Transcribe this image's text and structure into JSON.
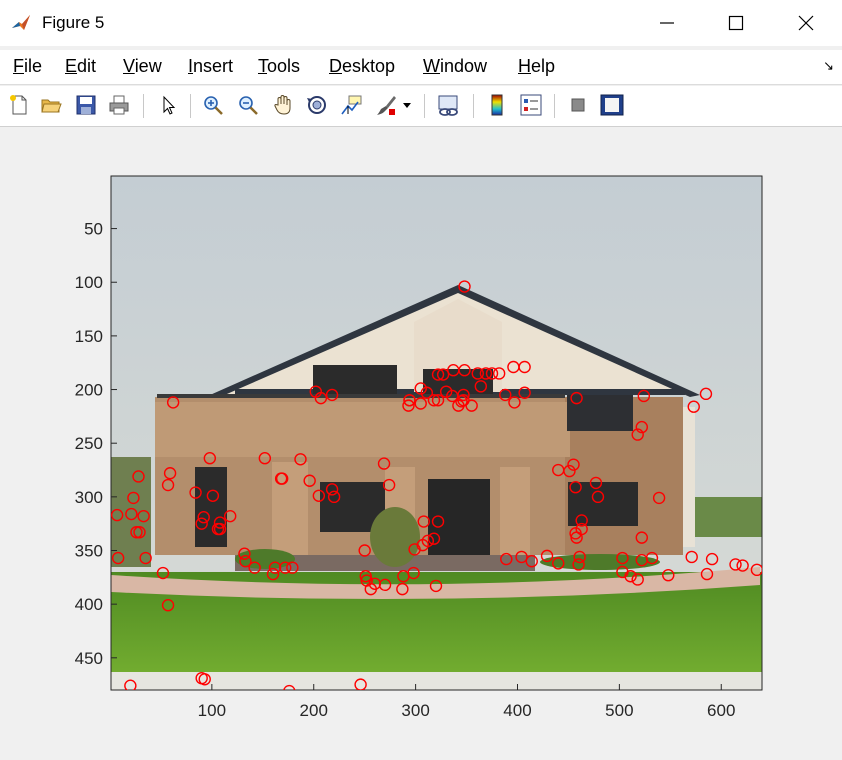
{
  "window": {
    "title": "Figure 5"
  },
  "menu": {
    "items": [
      {
        "mnemonic": "F",
        "rest": "ile"
      },
      {
        "mnemonic": "E",
        "rest": "dit"
      },
      {
        "mnemonic": "V",
        "rest": "iew"
      },
      {
        "mnemonic": "I",
        "rest": "nsert"
      },
      {
        "mnemonic": "T",
        "rest": "ools"
      },
      {
        "mnemonic": "D",
        "rest": "esktop"
      },
      {
        "mnemonic": "W",
        "rest": "indow"
      },
      {
        "mnemonic": "H",
        "rest": "elp"
      }
    ]
  },
  "toolbar": {
    "icons": [
      "new-figure-icon",
      "open-file-icon",
      "save-icon",
      "print-icon",
      "select-arrow-icon",
      "zoom-in-icon",
      "zoom-out-icon",
      "pan-hand-icon",
      "rotate-3d-icon",
      "data-cursor-icon",
      "brush-icon",
      "brush-dropdown-icon",
      "link-plot-icon",
      "colorbar-icon",
      "legend-icon",
      "hide-plot-tools-icon",
      "show-plot-tools-icon"
    ]
  },
  "axes": {
    "x_ticks": [
      "100",
      "200",
      "300",
      "400",
      "500",
      "600"
    ],
    "y_ticks": [
      "50",
      "100",
      "150",
      "200",
      "250",
      "300",
      "350",
      "400",
      "450"
    ],
    "x_range": [
      1,
      640
    ],
    "y_range": [
      1,
      480
    ],
    "y_reversed": true,
    "marker_color": "#ff0000"
  },
  "colors": {
    "sky": "#cfd6da",
    "roof": "#2f3640",
    "brick": "#b08c6a",
    "grass": "#5f9a2a",
    "walkway": "#d8b8a8"
  },
  "chart_data": {
    "type": "scatter",
    "x": [
      348,
      585,
      573,
      202,
      218,
      207,
      294,
      293,
      318,
      322,
      311,
      336,
      347,
      305,
      294,
      305,
      407,
      396,
      407,
      322,
      327,
      337,
      348,
      361,
      369,
      375,
      382,
      364,
      330,
      342,
      355,
      345,
      388,
      397,
      347,
      458,
      524,
      522,
      518,
      440,
      62,
      59,
      57,
      98,
      101,
      152,
      187,
      269,
      274,
      168,
      218,
      220,
      205,
      108,
      106,
      108,
      118,
      169,
      196,
      84,
      90,
      92,
      28,
      23,
      21,
      7,
      33,
      29,
      26,
      35,
      52,
      8,
      132,
      133,
      142,
      160,
      162,
      172,
      179,
      251,
      260,
      270,
      287,
      298,
      299,
      307,
      312,
      322,
      308,
      318,
      250,
      252,
      256,
      288,
      320,
      389,
      404,
      414,
      429,
      440,
      460,
      461,
      458,
      457,
      503,
      503,
      511,
      518,
      522,
      532,
      548,
      571,
      586,
      591,
      614,
      621,
      635,
      451,
      455,
      457,
      477,
      479,
      463,
      463,
      522,
      539,
      57,
      20,
      93,
      90,
      176,
      246
    ],
    "y": [
      104,
      204,
      216,
      202,
      205,
      208,
      210,
      215,
      210,
      210,
      203,
      206,
      210,
      199,
      210,
      213,
      203,
      179,
      179,
      186,
      186,
      182,
      182,
      185,
      185,
      185,
      185,
      197,
      202,
      215,
      215,
      211,
      205,
      212,
      205,
      208,
      206,
      235,
      242,
      275,
      212,
      278,
      289,
      264,
      299,
      264,
      265,
      269,
      289,
      283,
      293,
      300,
      299,
      324,
      330,
      330,
      318,
      283,
      285,
      296,
      325,
      319,
      281,
      301,
      316,
      317,
      318,
      333,
      333,
      357,
      371,
      357,
      353,
      360,
      366,
      372,
      366,
      366,
      366,
      374,
      381,
      382,
      386,
      371,
      349,
      345,
      341,
      323,
      323,
      339,
      350,
      378,
      386,
      374,
      383,
      358,
      356,
      360,
      355,
      362,
      363,
      356,
      338,
      334,
      370,
      357,
      374,
      377,
      359,
      357,
      373,
      356,
      372,
      358,
      363,
      364,
      368,
      276,
      270,
      291,
      287,
      300,
      322,
      330,
      338,
      301,
      401,
      476,
      470,
      469,
      481,
      475
    ]
  }
}
